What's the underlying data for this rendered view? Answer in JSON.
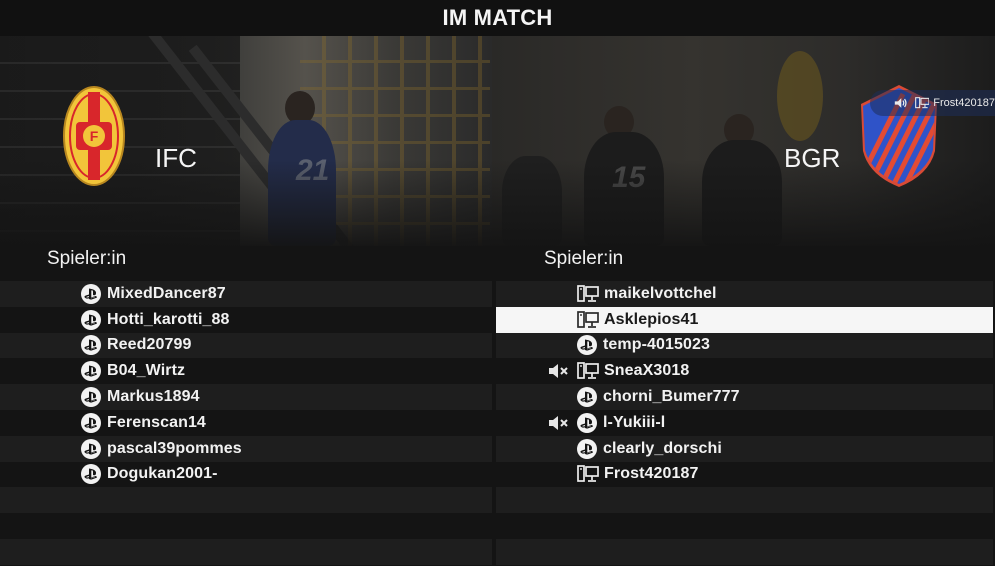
{
  "header": {
    "title": "IM MATCH"
  },
  "home": {
    "team_name": "IFC",
    "section_label": "Spieler:in",
    "players": [
      {
        "name": "MixedDancer87",
        "platform": "playstation-icon",
        "muted": false
      },
      {
        "name": "Hotti_karotti_88",
        "platform": "playstation-icon",
        "muted": false
      },
      {
        "name": "Reed20799",
        "platform": "playstation-icon",
        "muted": false
      },
      {
        "name": "B04_Wirtz",
        "platform": "playstation-icon",
        "muted": false
      },
      {
        "name": "Markus1894",
        "platform": "playstation-icon",
        "muted": false
      },
      {
        "name": "Ferenscan14",
        "platform": "playstation-icon",
        "muted": false
      },
      {
        "name": "pascal39pommes",
        "platform": "playstation-icon",
        "muted": false
      },
      {
        "name": "Dogukan2001-",
        "platform": "playstation-icon",
        "muted": false
      }
    ]
  },
  "away": {
    "team_name": "BGR",
    "section_label": "Spieler:in",
    "players": [
      {
        "name": "maikelvottchel",
        "platform": "pc-icon",
        "muted": false
      },
      {
        "name": "Asklepios41",
        "platform": "pc-icon",
        "muted": false,
        "selected": true
      },
      {
        "name": "temp-4015023",
        "platform": "playstation-icon",
        "muted": false
      },
      {
        "name": "SneaX3018",
        "platform": "pc-icon",
        "muted": true
      },
      {
        "name": "chorni_Bumer777",
        "platform": "playstation-icon",
        "muted": false
      },
      {
        "name": "l-Yukiii-l",
        "platform": "playstation-icon",
        "muted": true
      },
      {
        "name": "clearly_dorschi",
        "platform": "playstation-icon",
        "muted": false
      },
      {
        "name": "Frost420187",
        "platform": "pc-icon",
        "muted": false
      }
    ]
  },
  "voice_chat": {
    "speaker": "Frost420187",
    "icon": "speaker-icon"
  },
  "colors": {
    "selected_row": "#f6f6f6",
    "row_odd": "#1e1e1e",
    "row_even": "#141414",
    "home_crest_primary": "#f2c53a",
    "home_crest_accent": "#d8262b",
    "away_crest_primary": "#2f53c8",
    "away_crest_accent": "#e24b34"
  }
}
